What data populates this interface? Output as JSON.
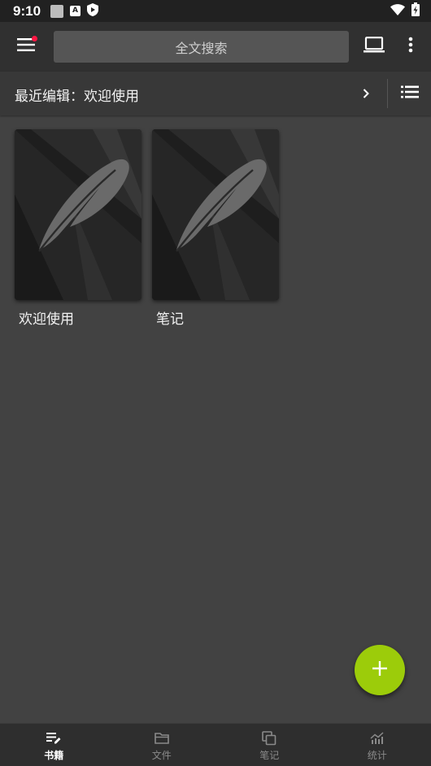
{
  "status_bar": {
    "time": "9:10",
    "notification_icons": [
      "gallery-icon",
      "a-app-icon",
      "shield-play-icon"
    ],
    "system_icons": [
      "wifi-icon",
      "battery-charging-icon"
    ],
    "a_glyph": "A"
  },
  "app_bar": {
    "menu_icon": "hamburger-menu-icon",
    "has_notification_dot": true,
    "search_placeholder": "全文搜索",
    "laptop_icon": "laptop-icon",
    "more_icon": "more-vert-icon"
  },
  "recent": {
    "label": "最近编辑：欢迎使用",
    "chevron_icon": "chevron-right-icon",
    "list_icon": "list-view-icon"
  },
  "books": [
    {
      "title": "欢迎使用",
      "cover_icon": "feather-icon"
    },
    {
      "title": "笔记",
      "cover_icon": "feather-icon"
    }
  ],
  "fab": {
    "icon": "plus-icon"
  },
  "bottom_nav": {
    "items": [
      {
        "label": "书籍",
        "icon": "books-edit-icon",
        "active": true
      },
      {
        "label": "文件",
        "icon": "folder-icon",
        "active": false
      },
      {
        "label": "笔记",
        "icon": "notes-copy-icon",
        "active": false
      },
      {
        "label": "统计",
        "icon": "stats-chart-icon",
        "active": false
      }
    ]
  },
  "colors": {
    "background": "#424242",
    "status_bar": "#212121",
    "app_bar": "#303030",
    "search_box": "#555555",
    "recent_bar": "#383838",
    "fab": "#9ccc0a",
    "bottom_nav": "#2e2e2e",
    "active_nav_label": "#ffffff",
    "inactive_nav_label": "#8a8a8a",
    "notification_dot": "#ff1744"
  }
}
